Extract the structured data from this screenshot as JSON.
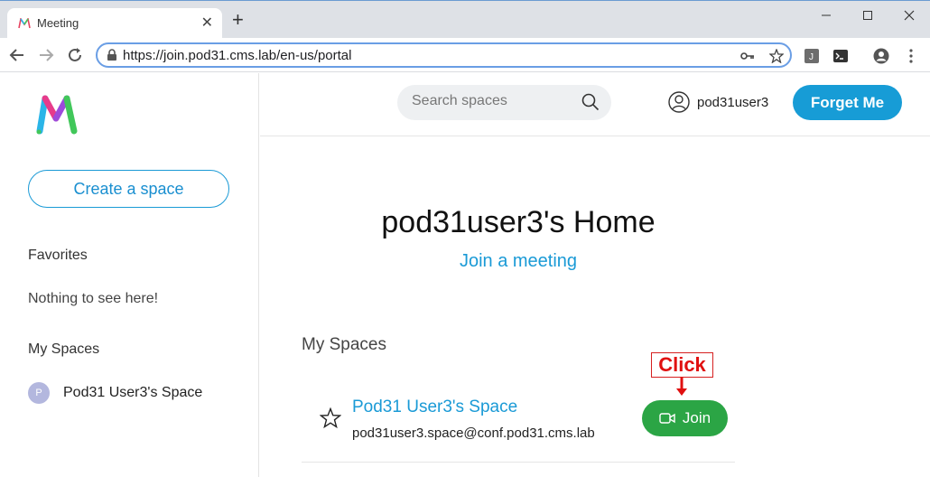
{
  "browser": {
    "tab_title": "Meeting",
    "url": "https://join.pod31.cms.lab/en-us/portal"
  },
  "search": {
    "placeholder": "Search spaces"
  },
  "user": {
    "name": "pod31user3"
  },
  "header": {
    "forget_label": "Forget Me"
  },
  "sidebar": {
    "create_label": "Create a space",
    "favorites_heading": "Favorites",
    "favorites_empty": "Nothing to see here!",
    "myspaces_heading": "My Spaces",
    "items": [
      {
        "avatar_letter": "P",
        "label": "Pod31 User3's Space"
      }
    ]
  },
  "main": {
    "title": "pod31user3's Home",
    "join_link": "Join a meeting",
    "myspaces_heading": "My Spaces",
    "spaces": [
      {
        "name": "Pod31 User3's Space",
        "address": "pod31user3.space@conf.pod31.cms.lab",
        "join_label": "Join"
      }
    ]
  },
  "annotation": {
    "callout": "Click"
  },
  "colors": {
    "accent": "#179cd6",
    "join_green": "#2ba545",
    "callout_red": "#e01010"
  }
}
